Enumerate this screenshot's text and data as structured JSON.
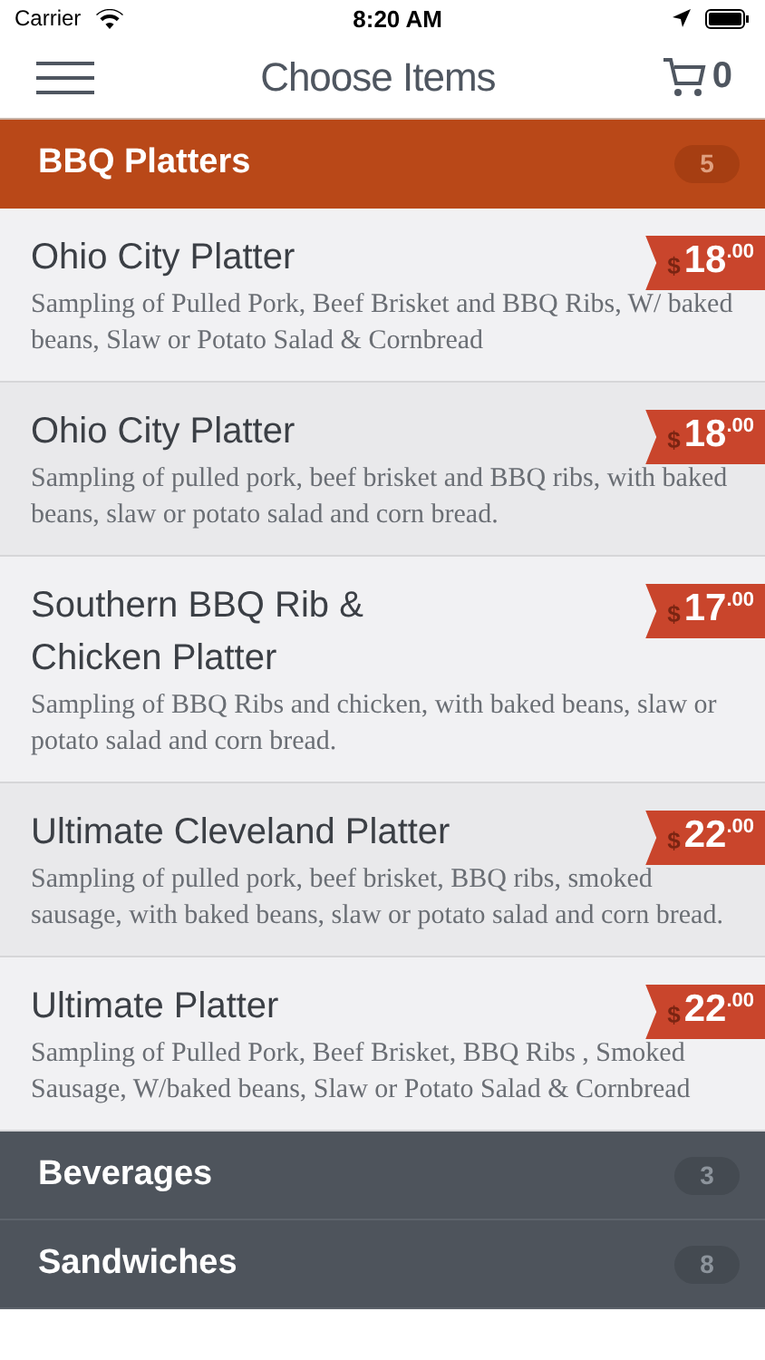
{
  "status_bar": {
    "carrier": "Carrier",
    "time": "8:20 AM"
  },
  "nav": {
    "title": "Choose Items",
    "cart_count": "0"
  },
  "categories": [
    {
      "name": "BBQ Platters",
      "count": "5",
      "expanded": true,
      "items": [
        {
          "name": "Ohio City Platter",
          "description": "Sampling of Pulled Pork, Beef Brisket and BBQ Ribs, W/ baked beans, Slaw or Potato Salad & Cornbread",
          "currency": "$",
          "price": "18",
          "cents": ".00"
        },
        {
          "name": "Ohio City Platter",
          "description": "Sampling of pulled pork, beef brisket and BBQ ribs, with baked beans, slaw or potato salad and corn bread.",
          "currency": "$",
          "price": "18",
          "cents": ".00"
        },
        {
          "name": "Southern BBQ Rib & Chicken Platter",
          "description": "Sampling of BBQ Ribs and chicken, with baked beans, slaw or potato salad and corn bread.",
          "currency": "$",
          "price": "17",
          "cents": ".00"
        },
        {
          "name": "Ultimate Cleveland Platter",
          "description": "Sampling of pulled pork, beef brisket, BBQ ribs, smoked sausage, with baked beans, slaw or potato salad and corn bread.",
          "currency": "$",
          "price": "22",
          "cents": ".00"
        },
        {
          "name": "Ultimate Platter",
          "description": "Sampling of Pulled Pork, Beef Brisket, BBQ Ribs , Smoked Sausage, W/baked beans, Slaw or Potato Salad & Cornbread",
          "currency": "$",
          "price": "22",
          "cents": ".00"
        }
      ]
    },
    {
      "name": "Beverages",
      "count": "3",
      "expanded": false
    },
    {
      "name": "Sandwiches",
      "count": "8",
      "expanded": false
    }
  ]
}
